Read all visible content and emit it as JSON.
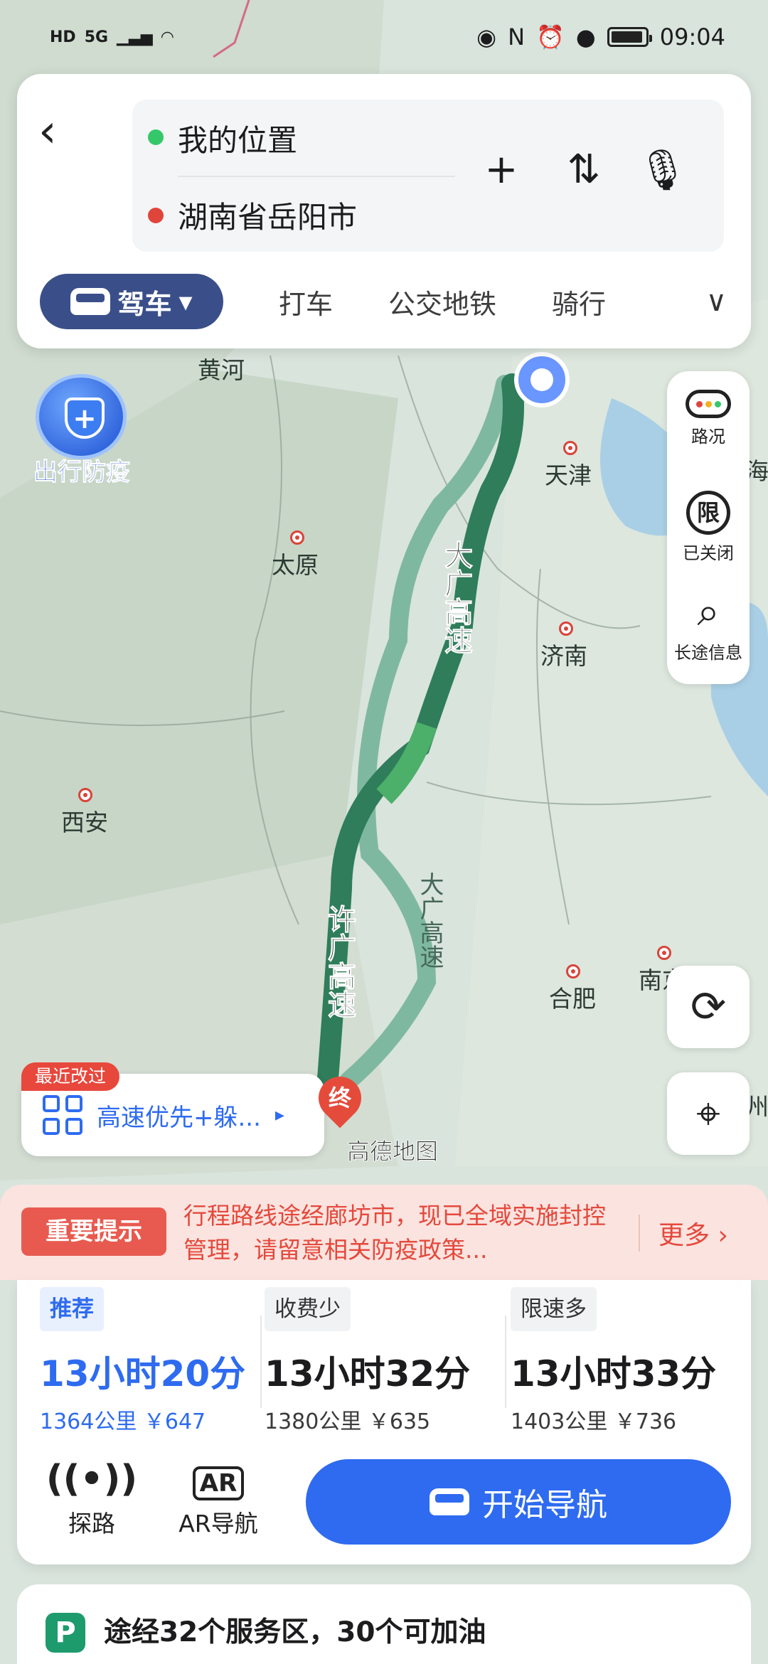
{
  "status_bar": {
    "hd": "HD",
    "network": "5G",
    "time": "09:04"
  },
  "search": {
    "origin": "我的位置",
    "destination": "湖南省岳阳市"
  },
  "icons": {
    "back": "chevron-left-icon",
    "add": "plus-icon",
    "swap": "swap-icon",
    "voice": "microphone-icon"
  },
  "modes": {
    "active": "驾车",
    "items": [
      "打车",
      "公交地铁",
      "骑行"
    ]
  },
  "epidemic_badge": "出行防疫",
  "right_panel": [
    {
      "label": "路况"
    },
    {
      "label": "已关闭",
      "glyph": "限"
    },
    {
      "label": "长途信息"
    }
  ],
  "map": {
    "cities": [
      "黄河",
      "天津",
      "太原",
      "济南",
      "西安",
      "合肥",
      "南京",
      "海",
      "州"
    ],
    "roads": [
      "大广高速",
      "大广高速",
      "许广高速"
    ],
    "brand": "高德地图",
    "end_marker": "终",
    "colors": {
      "route_main": "#2f7d5a",
      "route_alt": "#7fb8a0",
      "route_light": "#4caf6a"
    }
  },
  "preference": {
    "badge": "最近改过",
    "label": "高速优先+躲..."
  },
  "notice": {
    "badge": "重要提示",
    "text": "行程路线途经廊坊市，现已全域实施封控管理，请留意相关防疫政策...",
    "more": "更多"
  },
  "routes": [
    {
      "tag": "推荐",
      "time": "13小时20分",
      "dist": "1364公里 ￥647",
      "selected": true
    },
    {
      "tag": "收费少",
      "time": "13小时32分",
      "dist": "1380公里 ￥635",
      "selected": false
    },
    {
      "tag": "限速多",
      "time": "13小时33分",
      "dist": "1403公里 ￥736",
      "selected": false
    }
  ],
  "tools": [
    {
      "label": "探路"
    },
    {
      "label": "AR导航",
      "glyph": "AR"
    }
  ],
  "start_nav": "开始导航",
  "service": {
    "glyph": "P",
    "text": "途经32个服务区，30个可加油"
  }
}
